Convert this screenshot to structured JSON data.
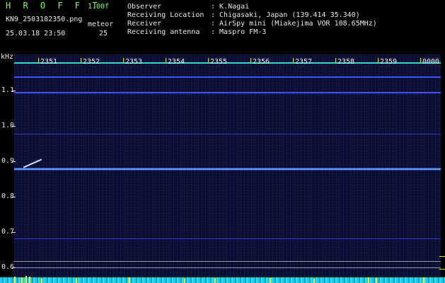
{
  "header": {
    "logo": "H R O F F T",
    "version": "1.00f",
    "filename": "KN9_2503182350.png",
    "meteor_label": "meteor",
    "datetime": "25.03.18 23:50",
    "count": "25",
    "observer_label": "Observer",
    "observer_value": ": K.Nagai",
    "location_label": "Receiving Location",
    "location_value": ": Chigasaki, Japan (139.414 35.340)",
    "receiver_label": "Receiver",
    "receiver_value": ": AirSpy mini (Miakejima VOR 108.65MHz)",
    "antenna_label": "Receiving antenna",
    "antenna_value": ": Maspro FM-3"
  },
  "y_axis": {
    "unit": "kHz",
    "labels": [
      "1.1",
      "1.0",
      "0.9",
      "0.8",
      "0.7",
      "0.6"
    ]
  },
  "x_axis": {
    "labels": [
      "2351",
      "2352",
      "2353",
      "2354",
      "2355",
      "2356",
      "2357",
      "2358",
      "2359",
      "0000"
    ]
  },
  "colors": {
    "background": "#000000",
    "plot": "#0a0d2e",
    "header_green": "#7cff4a",
    "signal_blue": "#3a55ff",
    "meteor_yellow": "#f0ef2a",
    "noise_cyan": "#1ec8e6"
  }
}
